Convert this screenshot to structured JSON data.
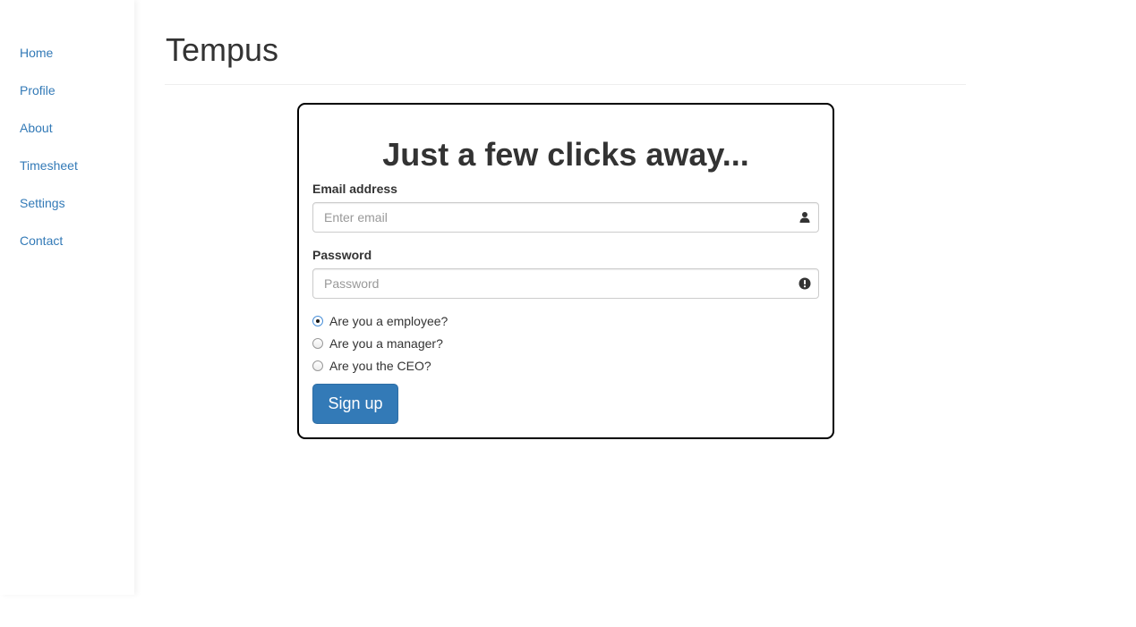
{
  "sidebar": {
    "items": [
      {
        "label": "Home"
      },
      {
        "label": "Profile"
      },
      {
        "label": "About"
      },
      {
        "label": "Timesheet"
      },
      {
        "label": "Settings"
      },
      {
        "label": "Contact"
      }
    ]
  },
  "header": {
    "title": "Tempus"
  },
  "form": {
    "heading": "Just a few clicks away...",
    "email": {
      "label": "Email address",
      "placeholder": "Enter email",
      "icon": "user-icon"
    },
    "password": {
      "label": "Password",
      "placeholder": "Password",
      "icon": "exclamation-circle-icon"
    },
    "roles": [
      {
        "label": "Are you a employee?",
        "checked": true
      },
      {
        "label": "Are you a manager?",
        "checked": false
      },
      {
        "label": "Are you the CEO?",
        "checked": false
      }
    ],
    "submit_label": "Sign up"
  },
  "colors": {
    "link": "#337ab7",
    "primary_button": "#337ab7",
    "text": "#333333",
    "card_border": "#000000"
  }
}
